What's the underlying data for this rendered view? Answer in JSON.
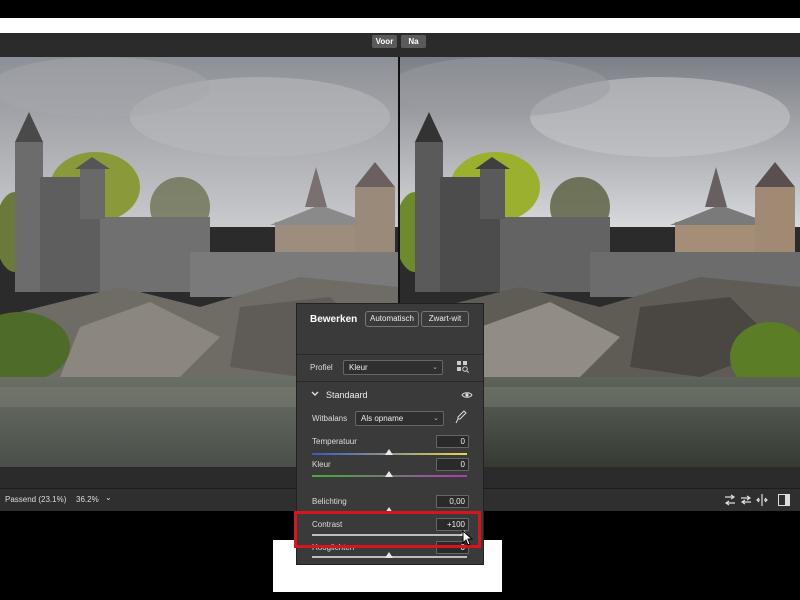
{
  "compare": {
    "before_label": "Voor",
    "after_label": "Na"
  },
  "status": {
    "fit_label": "Passend (23.1%)",
    "zoom_value": "36.2%",
    "zoom_chevron": "⌄"
  },
  "panel": {
    "title": "Bewerken",
    "auto_button": "Automatisch",
    "bw_button": "Zwart-wit",
    "profile_label": "Profiel",
    "profile_value": "Kleur",
    "section_title": "Standaard",
    "wb_label": "Witbalans",
    "wb_value": "Als opname",
    "sliders": [
      {
        "label": "Temperatuur",
        "value": "0",
        "position": 0.5
      },
      {
        "label": "Kleur",
        "value": "0",
        "position": 0.5
      },
      {
        "label": "Belichting",
        "value": "0,00",
        "position": 0.5
      },
      {
        "label": "Contrast",
        "value": "+100",
        "position": 1.0
      },
      {
        "label": "Hooglichten",
        "value": "0",
        "position": 0.5
      }
    ]
  },
  "icons": {
    "eye": "eye-icon",
    "eyedropper": "eyedropper-icon",
    "profile_browser": "profile-browser-icon",
    "section_chevron": "chevron-down-icon",
    "swap": "swap-icon",
    "split_view": "split-view-icon",
    "copy_settings": "copy-settings-icon",
    "panel_toggle": "panel-toggle-icon"
  },
  "colors": {
    "highlight": "#d8141e",
    "panel_bg": "#3a3a3a",
    "app_bg": "#2b2b2b"
  }
}
